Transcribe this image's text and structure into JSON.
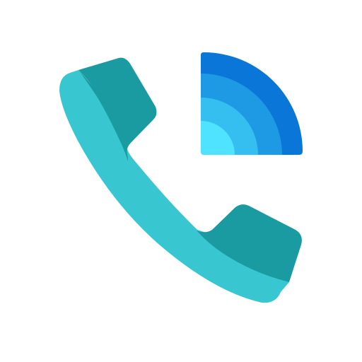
{
  "icon": {
    "name": "phone-signal-icon",
    "phone_icon_name": "phone-handset-icon",
    "signal_icon_name": "wireless-signal-icon",
    "colors": {
      "background": "#ffffff",
      "phone_light": "#38C6D1",
      "phone_dark": "#1A9BA1",
      "signal_ring_outer": "#0A76D8",
      "signal_ring_mid": "#1D9AE3",
      "signal_ring_inner": "#35BFF0",
      "signal_core": "#50E3FF"
    }
  }
}
